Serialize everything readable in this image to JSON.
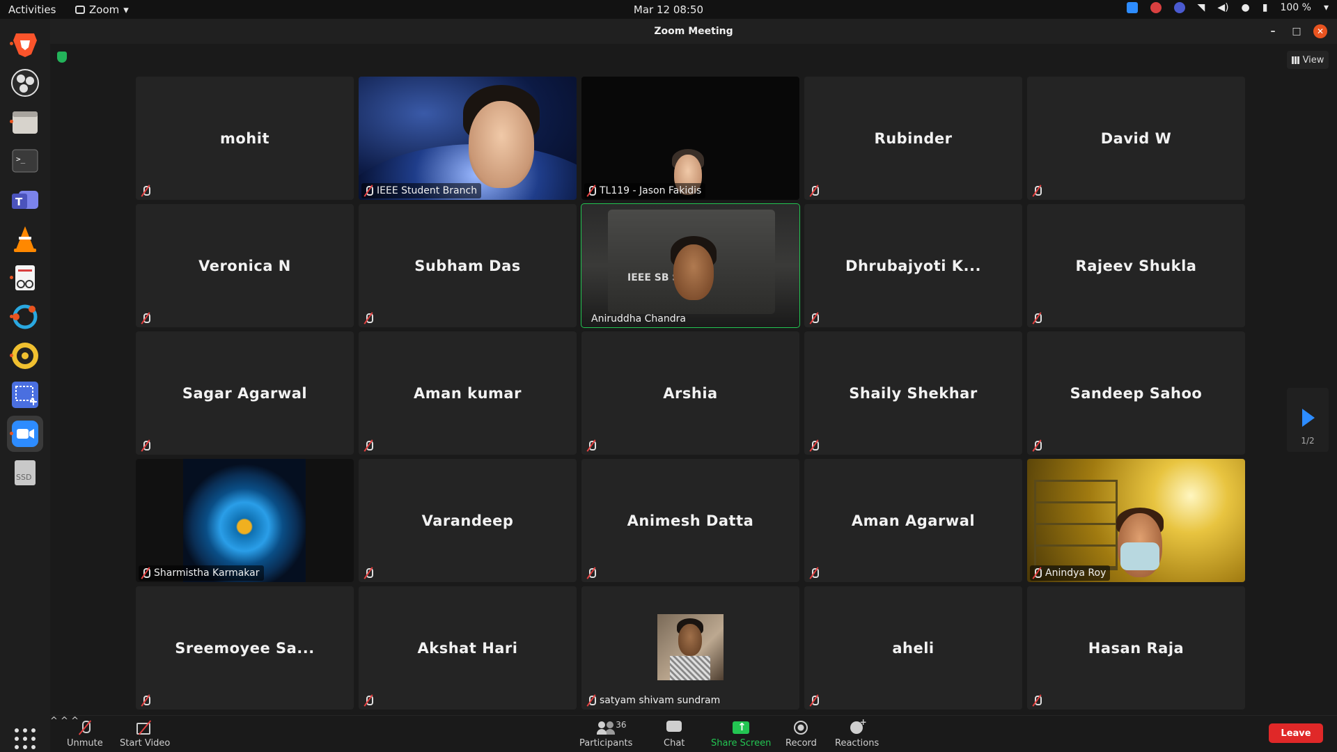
{
  "topbar": {
    "activities": "Activities",
    "app_name": "Zoom",
    "clock": "Mar 12  08:50",
    "battery": "100 %"
  },
  "dock": {
    "items": [
      "brave-browser",
      "obs-studio",
      "files",
      "terminal",
      "teams",
      "vlc",
      "document-viewer",
      "sync-app",
      "rhythmbox",
      "screenshot-tool",
      "zoom",
      "ssd-drive"
    ],
    "ssd_label": "SSD"
  },
  "window": {
    "title": "Zoom Meeting",
    "view_label": "View",
    "page_indicator": "1/2"
  },
  "participants": [
    {
      "name": "mohit",
      "video": false,
      "muted": true
    },
    {
      "name": "IEEE Student Branch",
      "video": true,
      "muted": true
    },
    {
      "name": "TL119 - Jason Fakidis",
      "video": true,
      "muted": true
    },
    {
      "name": "Rubinder",
      "video": false,
      "muted": true
    },
    {
      "name": "David W",
      "video": false,
      "muted": true
    },
    {
      "name": "Veronica N",
      "video": false,
      "muted": true
    },
    {
      "name": "Subham Das",
      "video": false,
      "muted": true
    },
    {
      "name": "Aniruddha Chandra",
      "video": true,
      "muted": false,
      "speaking": true,
      "overlay_text": "IEEE SB         SAPUR"
    },
    {
      "name": "Dhrubajyoti K...",
      "video": false,
      "muted": true
    },
    {
      "name": "Rajeev Shukla",
      "video": false,
      "muted": true
    },
    {
      "name": "Sagar Agarwal",
      "video": false,
      "muted": true
    },
    {
      "name": "Aman kumar",
      "video": false,
      "muted": true
    },
    {
      "name": "Arshia",
      "video": false,
      "muted": true
    },
    {
      "name": "Shaily Shekhar",
      "video": false,
      "muted": true
    },
    {
      "name": "Sandeep Sahoo",
      "video": false,
      "muted": true
    },
    {
      "name": "Sharmistha Karmakar",
      "video": true,
      "muted": true
    },
    {
      "name": "Varandeep",
      "video": false,
      "muted": true
    },
    {
      "name": "Animesh Datta",
      "video": false,
      "muted": true
    },
    {
      "name": "Aman Agarwal",
      "video": false,
      "muted": true
    },
    {
      "name": "Anindya Roy",
      "video": true,
      "muted": true
    },
    {
      "name": "Sreemoyee Sa...",
      "video": false,
      "muted": true
    },
    {
      "name": "Akshat Hari",
      "video": false,
      "muted": true
    },
    {
      "name": "satyam shivam sundram",
      "video": true,
      "muted": true
    },
    {
      "name": "aheli",
      "video": false,
      "muted": true
    },
    {
      "name": "Hasan Raja",
      "video": false,
      "muted": true
    }
  ],
  "toolbar": {
    "unmute": "Unmute",
    "start_video": "Start Video",
    "participants": "Participants",
    "participant_count": "36",
    "chat": "Chat",
    "share_screen": "Share Screen",
    "record": "Record",
    "reactions": "Reactions",
    "leave": "Leave"
  },
  "colors": {
    "speaking_outline": "#23c552",
    "share_green": "#23c552",
    "leave_red": "#e02828",
    "accent_blue": "#2d8cff"
  }
}
